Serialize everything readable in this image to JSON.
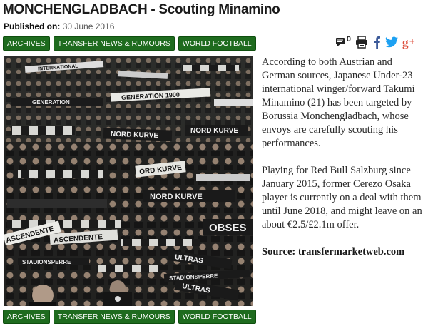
{
  "header": {
    "title": "MONCHENGLADBACH - Scouting Minamino",
    "published_label": "Published on:",
    "published_date": "30 June 2016"
  },
  "tags_top": [
    {
      "label": "ARCHIVES"
    },
    {
      "label": "TRANSFER NEWS & RUMOURS"
    },
    {
      "label": "WORLD FOOTBALL"
    }
  ],
  "toolbar": {
    "comment_count": "0",
    "icons": [
      "comment-icon",
      "print-icon",
      "facebook-icon",
      "twitter-icon",
      "google-plus-icon"
    ],
    "colors": {
      "facebook": "#3b5998",
      "twitter": "#1da1f2",
      "google_plus": "#dd4b39"
    }
  },
  "photo": {
    "scarf_texts": [
      "INTERNATIONAL",
      "GENERATION",
      "GENERATION 1900",
      "NORD KURVE",
      "NORD KURVE",
      "ORD KURVE",
      "NORD KURVE",
      "OBSES",
      "ASCENDENTE",
      "ASCENDENTE",
      "STADIONSPERRE",
      "ULTRAS",
      "STADIONSPERRE",
      "ULTRAS"
    ]
  },
  "article": {
    "paragraph1": "According to both Austrian and German sources, Japanese Under-23 international winger/forward Takumi Minamino (21) has been targeted by Borussia Monchengladbach, whose envoys are carefully scouting his performances.",
    "paragraph2": "Playing for Red Bull Salzburg since January 2015, former Cerezo Osaka player is currently on a deal with them until June 2018, and might leave on an about €2.5/£2.1m offer.",
    "source": "Source: transfermarketweb.com"
  },
  "tags_bottom": [
    {
      "label": "ARCHIVES"
    },
    {
      "label": "TRANSFER NEWS & RUMOURS"
    },
    {
      "label": "WORLD FOOTBALL"
    }
  ]
}
